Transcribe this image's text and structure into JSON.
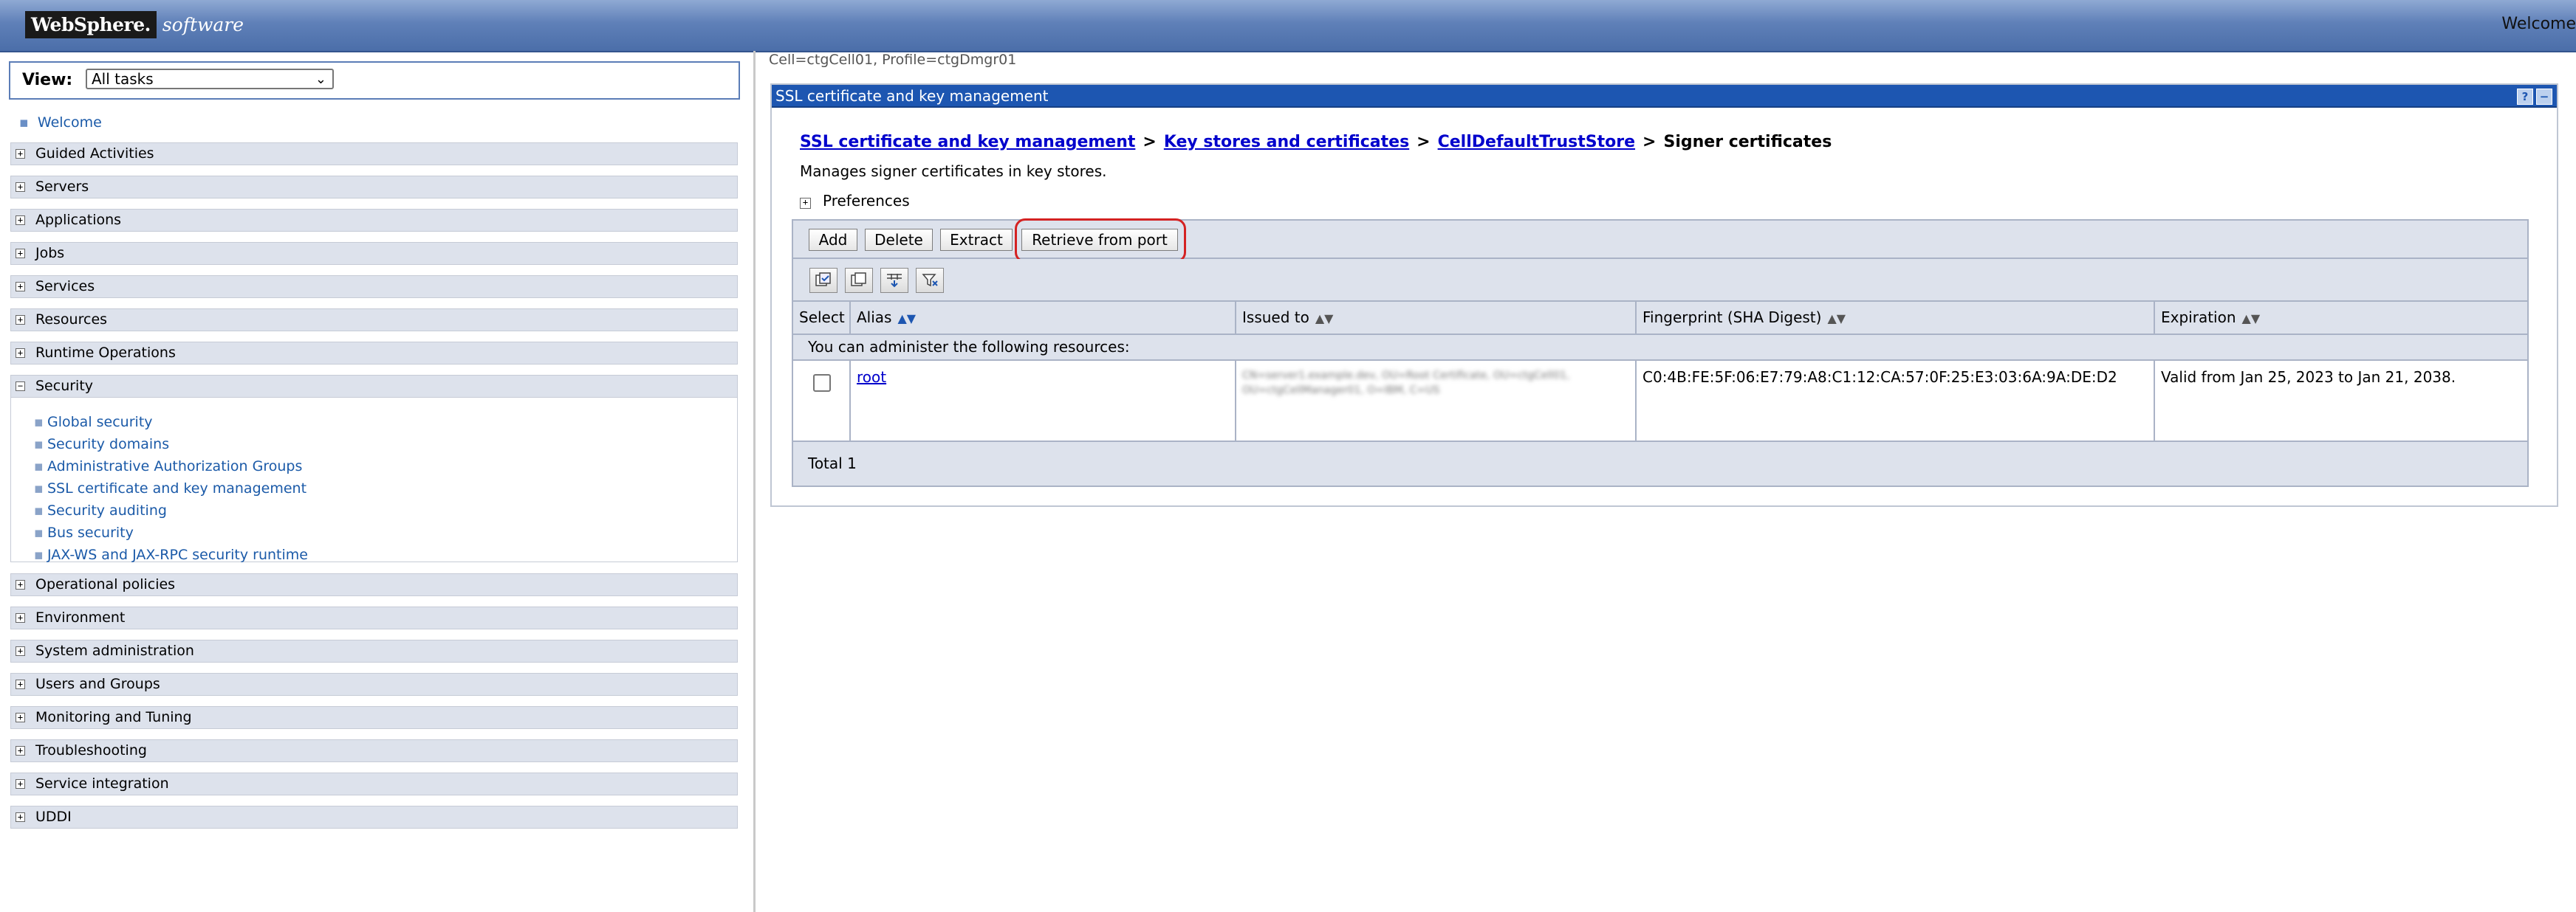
{
  "banner": {
    "logo_brand": "WebSphere.",
    "logo_product": "software",
    "welcome_text": "Welcome"
  },
  "nav": {
    "view_label": "View:",
    "view_selected": "All tasks",
    "welcome_link": "Welcome",
    "categories": [
      {
        "label": "Guided Activities",
        "expanded": false
      },
      {
        "label": "Servers",
        "expanded": false
      },
      {
        "label": "Applications",
        "expanded": false
      },
      {
        "label": "Jobs",
        "expanded": false
      },
      {
        "label": "Services",
        "expanded": false
      },
      {
        "label": "Resources",
        "expanded": false
      },
      {
        "label": "Runtime Operations",
        "expanded": false
      },
      {
        "label": "Security",
        "expanded": true
      },
      {
        "label": "Operational policies",
        "expanded": false
      },
      {
        "label": "Environment",
        "expanded": false
      },
      {
        "label": "System administration",
        "expanded": false
      },
      {
        "label": "Users and Groups",
        "expanded": false
      },
      {
        "label": "Monitoring and Tuning",
        "expanded": false
      },
      {
        "label": "Troubleshooting",
        "expanded": false
      },
      {
        "label": "Service integration",
        "expanded": false
      },
      {
        "label": "UDDI",
        "expanded": false
      }
    ],
    "security_items": [
      "Global security",
      "Security domains",
      "Administrative Authorization Groups",
      "SSL certificate and key management",
      "Security auditing",
      "Bus security",
      "JAX-WS and JAX-RPC security runtime"
    ],
    "expand_symbol": "+",
    "collapse_symbol": "−"
  },
  "content": {
    "cell_info": "Cell=ctgCell01, Profile=ctgDmgr01",
    "panel_title": "SSL certificate and key management",
    "panel_help": "?",
    "panel_minimize": "−",
    "breadcrumb": {
      "link1": "SSL certificate and key management",
      "link2": "Key stores and certificates",
      "link3": "CellDefaultTrustStore",
      "current": "Signer certificates",
      "separator": ">"
    },
    "description": "Manages signer certificates in key stores.",
    "preferences_label": "Preferences",
    "buttons": {
      "add": "Add",
      "delete": "Delete",
      "extract": "Extract",
      "retrieve": "Retrieve from port"
    },
    "table": {
      "headers": {
        "select": "Select",
        "alias": "Alias",
        "issued_to": "Issued to",
        "fingerprint": "Fingerprint (SHA Digest)",
        "expiration": "Expiration"
      },
      "resources_text": "You can administer the following resources:",
      "rows": [
        {
          "alias": "root",
          "issued_to": "CN=server1.example.dev, OU=Root Certificate, OU=ctgCell01, OU=ctgCellManager01, O=IBM, C=US",
          "fingerprint": "C0:4B:FE:5F:06:E7:79:A8:C1:12:CA:57:0F:25:E3:03:6A:9A:DE:D2",
          "expiration": "Valid from Jan 25, 2023 to Jan 21, 2038."
        }
      ],
      "total": "Total 1"
    }
  }
}
